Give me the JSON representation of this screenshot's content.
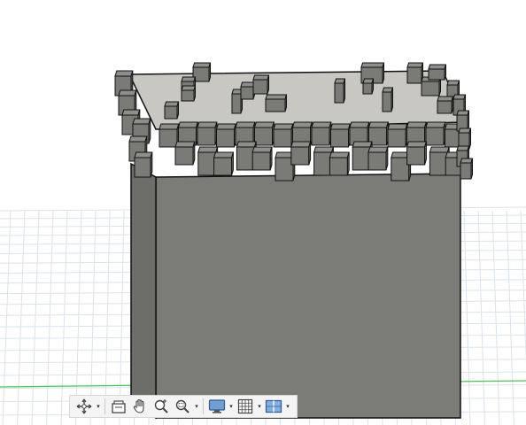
{
  "viewport": {
    "description_free": true,
    "model_colors": {
      "top_face": "#c8c7c2",
      "side_face": "#7c7d78",
      "side_face_dark": "#6a6b66",
      "edge": "#111111",
      "grid_line": "#d9e2ea",
      "axis_green": "#3cc84a"
    }
  },
  "toolbar": {
    "items": [
      {
        "name": "orbit",
        "icon": "orbit-icon",
        "has_menu": true
      },
      {
        "name": "look-at",
        "icon": "look-at-icon",
        "has_menu": false
      },
      {
        "name": "pan",
        "icon": "pan-hand-icon",
        "has_menu": false
      },
      {
        "name": "zoom",
        "icon": "zoom-icon",
        "has_menu": false
      },
      {
        "name": "fit",
        "icon": "zoom-window-icon",
        "has_menu": true
      },
      {
        "name": "display-settings",
        "icon": "display-settings-icon",
        "has_menu": true
      },
      {
        "name": "grid-snaps",
        "icon": "grid-icon",
        "has_menu": true
      },
      {
        "name": "viewports",
        "icon": "viewports-icon",
        "has_menu": true
      }
    ],
    "caret": "▾"
  }
}
